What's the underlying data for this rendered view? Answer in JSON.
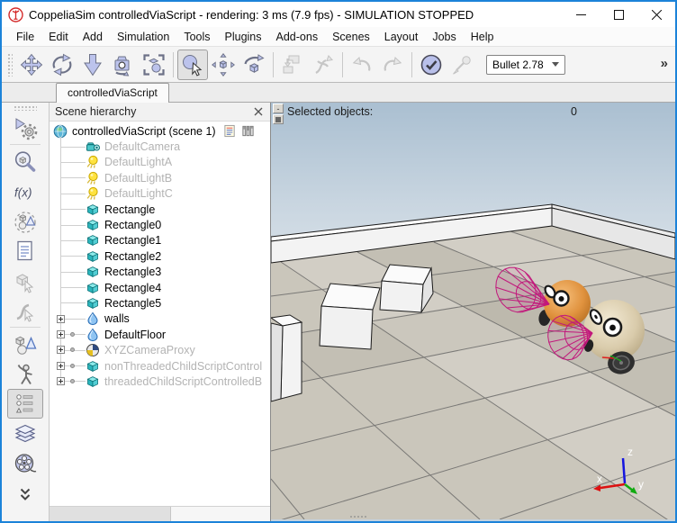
{
  "window": {
    "title": "CoppeliaSim controlledViaScript - rendering: 3 ms (7.9 fps) - SIMULATION STOPPED",
    "controls": [
      {
        "name": "minimize"
      },
      {
        "name": "maximize"
      },
      {
        "name": "close"
      }
    ]
  },
  "menu_bar": {
    "items": [
      "File",
      "Edit",
      "Add",
      "Simulation",
      "Tools",
      "Plugins",
      "Add-ons",
      "Scenes",
      "Layout",
      "Jobs",
      "Help"
    ]
  },
  "toolbar": {
    "buttons": [
      {
        "name": "camera-pan",
        "enabled": true,
        "pressed": false
      },
      {
        "name": "camera-rotate",
        "enabled": true,
        "pressed": false
      },
      {
        "name": "camera-zoom",
        "enabled": true,
        "pressed": false
      },
      {
        "name": "camera-shift-angle",
        "enabled": true,
        "pressed": false
      },
      {
        "name": "fit-to-view",
        "enabled": true,
        "pressed": false
      },
      {
        "separator": true
      },
      {
        "name": "object-select",
        "enabled": true,
        "pressed": true
      },
      {
        "name": "object-shift",
        "enabled": true,
        "pressed": false
      },
      {
        "name": "object-rotate",
        "enabled": true,
        "pressed": false
      },
      {
        "separator": true
      },
      {
        "name": "assemble",
        "enabled": false,
        "pressed": false
      },
      {
        "name": "transfer-dna",
        "enabled": false,
        "pressed": false
      },
      {
        "separator": true
      },
      {
        "name": "undo",
        "enabled": false,
        "pressed": false
      },
      {
        "name": "redo",
        "enabled": false,
        "pressed": false
      },
      {
        "separator": true
      },
      {
        "name": "toggle-dynamics",
        "enabled": true,
        "pressed": false
      },
      {
        "name": "visualize-dynamic-content",
        "enabled": false,
        "pressed": false
      }
    ],
    "engine_selector": {
      "value": "Bullet 2.78"
    },
    "overflow_label": "»"
  },
  "left_toolbar": {
    "buttons": [
      {
        "name": "simulation-settings",
        "enabled": true,
        "pressed": false,
        "sep_after": true
      },
      {
        "name": "scene-object-properties",
        "enabled": true,
        "pressed": false
      },
      {
        "name": "calculation-modules",
        "enabled": true,
        "pressed": false
      },
      {
        "name": "collections",
        "enabled": true,
        "pressed": false
      },
      {
        "name": "scripts",
        "enabled": true,
        "pressed": false
      },
      {
        "name": "shape-edit-mode",
        "enabled": false,
        "pressed": false
      },
      {
        "name": "path-edit-mode",
        "enabled": false,
        "pressed": false,
        "sep_after": true
      },
      {
        "name": "add-primitive-shape",
        "enabled": true,
        "pressed": false
      },
      {
        "name": "model-browser",
        "enabled": true,
        "pressed": false
      },
      {
        "name": "scene-hierarchy",
        "enabled": true,
        "pressed": true
      },
      {
        "name": "layers",
        "enabled": true,
        "pressed": false
      },
      {
        "name": "video-recorder",
        "enabled": true,
        "pressed": false
      },
      {
        "name": "more-options",
        "enabled": true,
        "pressed": false
      }
    ]
  },
  "scene_tabs": {
    "active": "controlledViaScript"
  },
  "hierarchy": {
    "header": "Scene hierarchy",
    "root": {
      "label": "controlledViaScript (scene 1)",
      "icon": "world"
    },
    "items": [
      {
        "label": "DefaultCamera",
        "icon": "camera",
        "disabled": true,
        "expandable": false,
        "dot": false
      },
      {
        "label": "DefaultLightA",
        "icon": "light",
        "disabled": true,
        "expandable": false,
        "dot": false
      },
      {
        "label": "DefaultLightB",
        "icon": "light",
        "disabled": true,
        "expandable": false,
        "dot": false
      },
      {
        "label": "DefaultLightC",
        "icon": "light",
        "disabled": true,
        "expandable": false,
        "dot": false
      },
      {
        "label": "Rectangle",
        "icon": "cuboid",
        "disabled": false,
        "expandable": false,
        "dot": false
      },
      {
        "label": "Rectangle0",
        "icon": "cuboid",
        "disabled": false,
        "expandable": false,
        "dot": false
      },
      {
        "label": "Rectangle1",
        "icon": "cuboid",
        "disabled": false,
        "expandable": false,
        "dot": false
      },
      {
        "label": "Rectangle2",
        "icon": "cuboid",
        "disabled": false,
        "expandable": false,
        "dot": false
      },
      {
        "label": "Rectangle3",
        "icon": "cuboid",
        "disabled": false,
        "expandable": false,
        "dot": false
      },
      {
        "label": "Rectangle4",
        "icon": "cuboid",
        "disabled": false,
        "expandable": false,
        "dot": false
      },
      {
        "label": "Rectangle5",
        "icon": "cuboid",
        "disabled": false,
        "expandable": false,
        "dot": false
      },
      {
        "label": "walls",
        "icon": "shape",
        "disabled": false,
        "expandable": true,
        "dot": false
      },
      {
        "label": "DefaultFloor",
        "icon": "shape",
        "disabled": false,
        "expandable": true,
        "dot": true
      },
      {
        "label": "XYZCameraProxy",
        "icon": "proxy",
        "disabled": true,
        "expandable": true,
        "dot": true
      },
      {
        "label": "nonThreadedChildScriptControl",
        "icon": "cuboid",
        "disabled": true,
        "expandable": true,
        "dot": true
      },
      {
        "label": "threadedChildScriptControlledB",
        "icon": "cuboid",
        "disabled": true,
        "expandable": true,
        "dot": true
      }
    ]
  },
  "viewport": {
    "info_label": "Selected objects:",
    "info_value": "0",
    "axis_labels": {
      "x": "x",
      "y": "y",
      "z": "z"
    }
  },
  "colors": {
    "window_border": "#1c83d9",
    "toolbar_icon": "#bcc3ec",
    "sensor_cone": "#c2187c",
    "robot_a": "#e0923e",
    "robot_b": "#d9cbab",
    "floor": "#cac6bb"
  }
}
